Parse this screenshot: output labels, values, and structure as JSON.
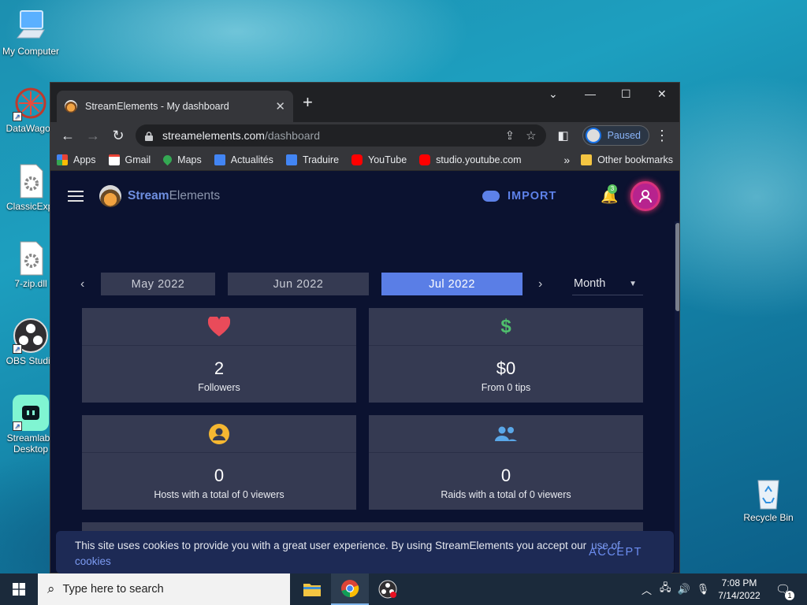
{
  "desktop": {
    "icons": [
      {
        "label": "My Computer"
      },
      {
        "label": "DataWagon"
      },
      {
        "label": "ClassicExpl"
      },
      {
        "label": "7-zip.dll"
      },
      {
        "label": "OBS Studio"
      },
      {
        "label": "Streamlabs Desktop"
      },
      {
        "label": "Recycle Bin"
      }
    ]
  },
  "browser": {
    "tab_title": "StreamElements - My dashboard",
    "tab_close": "✕",
    "new_tab": "+",
    "url_host": "streamelements.com",
    "url_path": "/dashboard",
    "profile_status": "Paused",
    "bookmarks": [
      {
        "label": "Apps",
        "color": "#ea4335"
      },
      {
        "label": "Gmail",
        "color": "#ea4335"
      },
      {
        "label": "Maps",
        "color": "#34a853"
      },
      {
        "label": "Actualités",
        "color": "#4285f4"
      },
      {
        "label": "Traduire",
        "color": "#4285f4"
      },
      {
        "label": "YouTube",
        "color": "#ff0000"
      },
      {
        "label": "studio.youtube.com",
        "color": "#ff0000"
      }
    ],
    "more_bookmarks": "»",
    "other_bookmarks": "Other bookmarks"
  },
  "page": {
    "logo_strong": "Stream",
    "logo_light": "Elements",
    "import_label": "IMPORT",
    "notification_count": "3",
    "months": [
      {
        "label": "May 2022",
        "active": false
      },
      {
        "label": "Jun 2022",
        "active": false
      },
      {
        "label": "Jul 2022",
        "active": true
      }
    ],
    "prev_arrow": "‹",
    "next_arrow": "›",
    "period": "Month",
    "cards": [
      {
        "value": "2",
        "label": "Followers",
        "icon": "heart-icon",
        "icon_color": "#e94b5a"
      },
      {
        "value": "$0",
        "label": "From 0 tips",
        "icon": "dollar-icon",
        "icon_color": "#4fc06d"
      },
      {
        "value": "0",
        "label": "Hosts with a total of 0 viewers",
        "icon": "person-icon",
        "icon_color": "#f5b731"
      },
      {
        "value": "0",
        "label": "Raids with a total of 0 viewers",
        "icon": "group-icon",
        "icon_color": "#5aa7e8"
      }
    ]
  },
  "cookie": {
    "text": "This site uses cookies to provide you with a great user experience. By using StreamElements you accept our",
    "link": "use of cookies",
    "accept": "ACCEPT"
  },
  "taskbar": {
    "search_placeholder": "Type here to search",
    "time": "7:08 PM",
    "date": "7/14/2022",
    "notification_badge": "1"
  }
}
